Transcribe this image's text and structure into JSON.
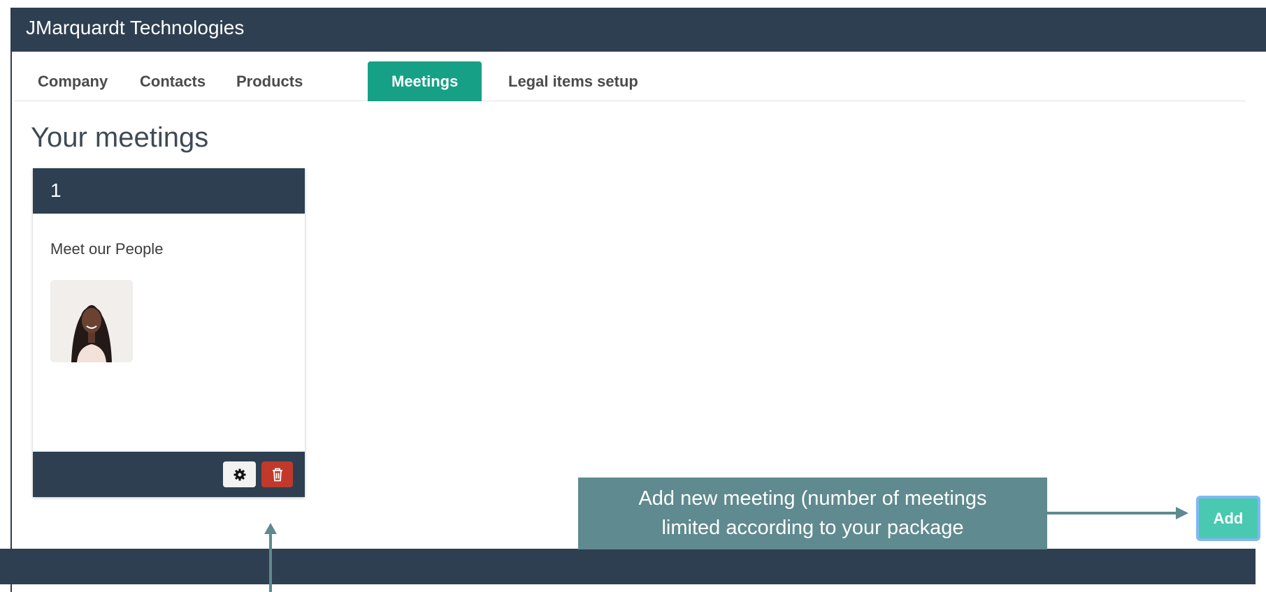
{
  "header": {
    "brand": "JMarquardt Technologies"
  },
  "tabs": [
    {
      "label": "Company",
      "active": false
    },
    {
      "label": "Contacts",
      "active": false
    },
    {
      "label": "Products",
      "active": false
    },
    {
      "label": "Meetings",
      "active": true
    },
    {
      "label": "Legal items setup",
      "active": false
    }
  ],
  "main": {
    "title": "Your meetings",
    "meetings": [
      {
        "number": "1",
        "title": "Meet our People",
        "settings_icon": "gear-icon",
        "delete_icon": "trash-icon"
      }
    ]
  },
  "actions": {
    "add_label": "Add"
  },
  "callout": {
    "line1": "Add new meeting (number of meetings",
    "line2": "limited according to your package"
  },
  "colors": {
    "navy": "#2e3f51",
    "tab_active": "#16a085",
    "add_button": "#48c9b0",
    "delete_button": "#c0392b",
    "callout": "#5f8a8f"
  }
}
